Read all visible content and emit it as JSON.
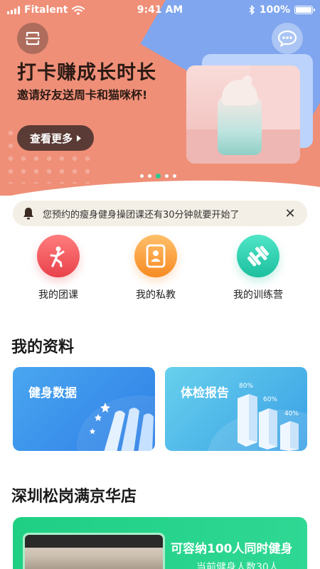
{
  "status_bar": {
    "carrier": "Fitalent",
    "time": "9:41 AM",
    "battery": "100%"
  },
  "hero": {
    "title": "打卡赚成长时长",
    "subtitle": "邀请好友送周卡和猫咪杯!",
    "more_label": "查看更多",
    "page_count": 6,
    "active_page": 3
  },
  "notice": {
    "text": "您预约的瘦身健身操团课还有30分钟就要开始了"
  },
  "shortcuts": [
    {
      "label": "我的团课",
      "icon": "running-person-icon"
    },
    {
      "label": "我的私教",
      "icon": "trainer-card-icon"
    },
    {
      "label": "我的训练营",
      "icon": "dumbbell-icon"
    }
  ],
  "profile": {
    "title": "我的资料",
    "cards": [
      {
        "title": "健身数据"
      },
      {
        "title": "体检报告",
        "bars": [
          "80%",
          "60%",
          "40%"
        ]
      }
    ]
  },
  "store": {
    "title": "深圳松岗满京华店",
    "capacity": "可容纳100人同时健身",
    "current": "当前健身人数30人"
  },
  "colors": {
    "hero_bg": "#ef8f78",
    "accent_green": "#2fc88f",
    "shortcut_red": "#e8424b",
    "shortcut_orange": "#f78a22",
    "shortcut_teal": "#1cbf9f"
  }
}
